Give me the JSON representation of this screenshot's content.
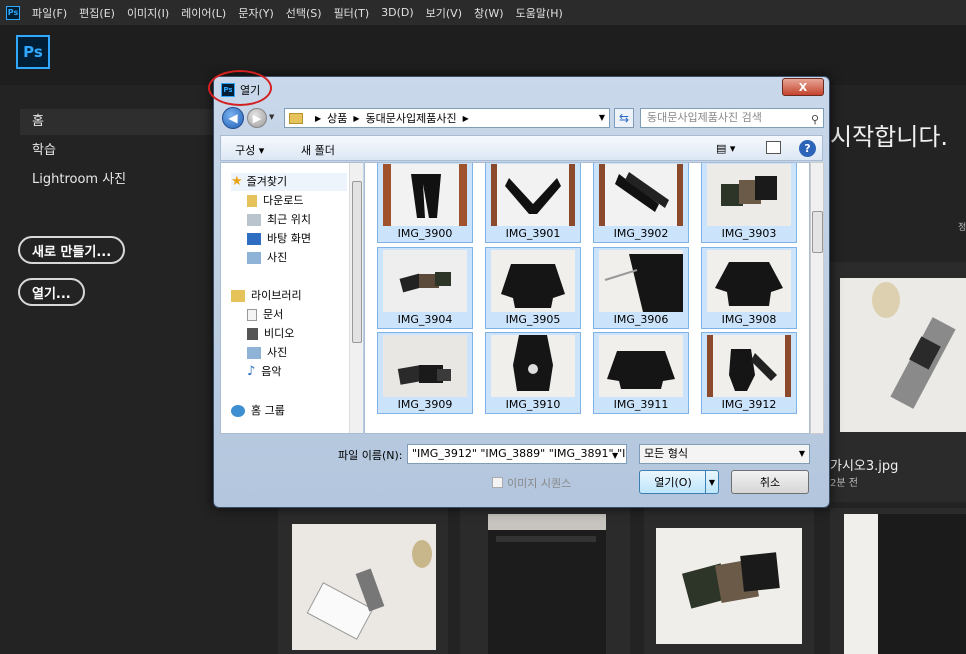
{
  "menubar": {
    "items": [
      "파일(F)",
      "편집(E)",
      "이미지(I)",
      "레이어(L)",
      "문자(Y)",
      "선택(S)",
      "필터(T)",
      "3D(D)",
      "보기(V)",
      "창(W)",
      "도움말(H)"
    ]
  },
  "app": {
    "logo": "Ps"
  },
  "sidebar": {
    "items": [
      {
        "label": "홈"
      },
      {
        "label": "학습"
      },
      {
        "label": "Lightroom 사진"
      }
    ],
    "new_button": "새로 만들기...",
    "open_button": "열기..."
  },
  "home": {
    "welcome_fragment": "시작합니다.",
    "recent_caption": "가시오3.jpg",
    "recent_time": "2분 전",
    "edge_label": "정"
  },
  "dialog": {
    "title": "열기",
    "close": "X",
    "breadcrumb": [
      "상품",
      "동대문사입제품사진"
    ],
    "search_placeholder": "동대문사입제품사진 검색",
    "toolbar": {
      "organize": "구성 ▾",
      "new_folder": "새 폴더",
      "help": "?"
    },
    "nav": {
      "favorites": "즐겨찾기",
      "favorites_items": [
        "다운로드",
        "최근 위치",
        "바탕 화면",
        "사진"
      ],
      "libraries": "라이브러리",
      "libraries_items": [
        "문서",
        "비디오",
        "사진",
        "음악"
      ],
      "homegroup": "홈 그룹"
    },
    "files": [
      {
        "name": "IMG_3900"
      },
      {
        "name": "IMG_3901"
      },
      {
        "name": "IMG_3902"
      },
      {
        "name": "IMG_3903"
      },
      {
        "name": "IMG_3904"
      },
      {
        "name": "IMG_3905"
      },
      {
        "name": "IMG_3906"
      },
      {
        "name": "IMG_3908"
      },
      {
        "name": "IMG_3909"
      },
      {
        "name": "IMG_3910"
      },
      {
        "name": "IMG_3911"
      },
      {
        "name": "IMG_3912"
      }
    ],
    "filename_label": "파일 이름(N):",
    "filename_value": "\"IMG_3912\" \"IMG_3889\" \"IMG_3891\" \"IN",
    "filetype": "모든 형식",
    "image_sequence": "이미지 시퀀스",
    "open_button": "열기(O)",
    "cancel_button": "취소"
  },
  "colors": {
    "ps_blue": "#31a8ff",
    "ps_dark": "#001e36",
    "annotation_red": "#d32020",
    "selection_blue": "#cce4fb"
  }
}
